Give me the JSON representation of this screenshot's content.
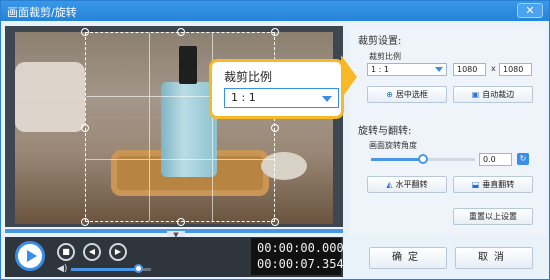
{
  "window": {
    "title": "画面裁剪/旋转",
    "close_symbol": "✕"
  },
  "player": {
    "current_time": "00:00:00.000",
    "total_time": "00:00:07.354",
    "volume_fraction": 0.85
  },
  "crop": {
    "section_title": "裁剪设置:",
    "ratio_label": "裁剪比例",
    "ratio_value": "1 : 1",
    "width": "1080",
    "height": "1080",
    "times_symbol": "x",
    "center_button": "居中选框",
    "auto_button": "自动裁边"
  },
  "rotate": {
    "section_title": "旋转与翻转:",
    "angle_label": "画面旋转角度",
    "angle_value": "0.0",
    "angle_fraction": 0.5,
    "hflip_button": "水平翻转",
    "vflip_button": "垂直翻转",
    "reset_button": "重置以上设置"
  },
  "callout": {
    "label": "裁剪比例",
    "value": "1 : 1"
  },
  "footer": {
    "ok": "确定",
    "cancel": "取消"
  }
}
